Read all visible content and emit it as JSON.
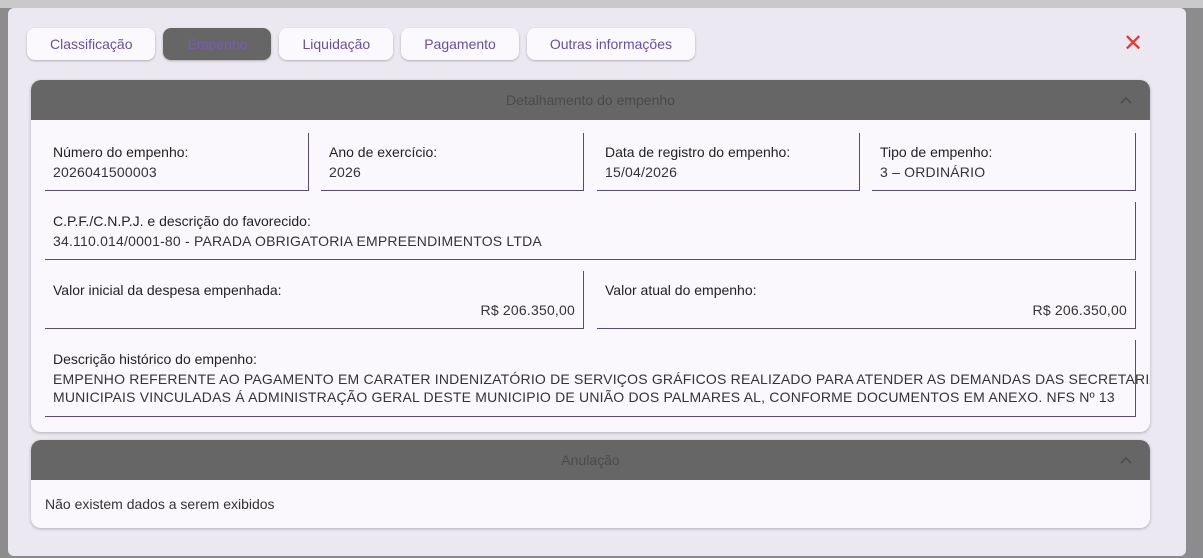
{
  "tabs": [
    {
      "label": "Classificação",
      "active": false
    },
    {
      "label": "Empenho",
      "active": true
    },
    {
      "label": "Liquidação",
      "active": false
    },
    {
      "label": "Pagamento",
      "active": false
    },
    {
      "label": "Outras informações",
      "active": false
    }
  ],
  "close_icon": "close-icon",
  "detalhamento": {
    "title": "Detalhamento do empenho",
    "numero": {
      "label": "Número do empenho:",
      "value": "2026041500003"
    },
    "ano": {
      "label": "Ano de exercício:",
      "value": "2026"
    },
    "data_registro": {
      "label": "Data de registro do empenho:",
      "value": "15/04/2026"
    },
    "tipo": {
      "label": "Tipo de empenho:",
      "value": "3 – ORDINÁRIO"
    },
    "favorecido": {
      "label": "C.P.F./C.N.P.J. e descrição do favorecido:",
      "value": "34.110.014/0001-80 - PARADA OBRIGATORIA EMPREENDIMENTOS LTDA"
    },
    "valor_inicial": {
      "label": "Valor inicial da despesa empenhada:",
      "value": "R$ 206.350,00"
    },
    "valor_atual": {
      "label": "Valor atual do empenho:",
      "value": "R$ 206.350,00"
    },
    "historico": {
      "label": "Descrição histórico do empenho:",
      "line1": "EMPENHO REFERENTE AO PAGAMENTO EM CARATER INDENIZATÓRIO DE SERVIÇOS GRÁFICOS REALIZADO PARA ATENDER AS DEMANDAS DAS SECRETARIAS",
      "line2": "MUNICIPAIS VINCULADAS Á ADMINISTRAÇÃO GERAL DESTE MUNICIPIO DE UNIÃO DOS PALMARES AL, CONFORME DOCUMENTOS EM ANEXO. NFS Nº 13"
    }
  },
  "anulacao": {
    "title": "Anulação",
    "empty_message": "Não existem dados a serem exibidos"
  },
  "colors": {
    "accent": "#6b4f9a",
    "close": "#e53935",
    "header": "#666666"
  }
}
